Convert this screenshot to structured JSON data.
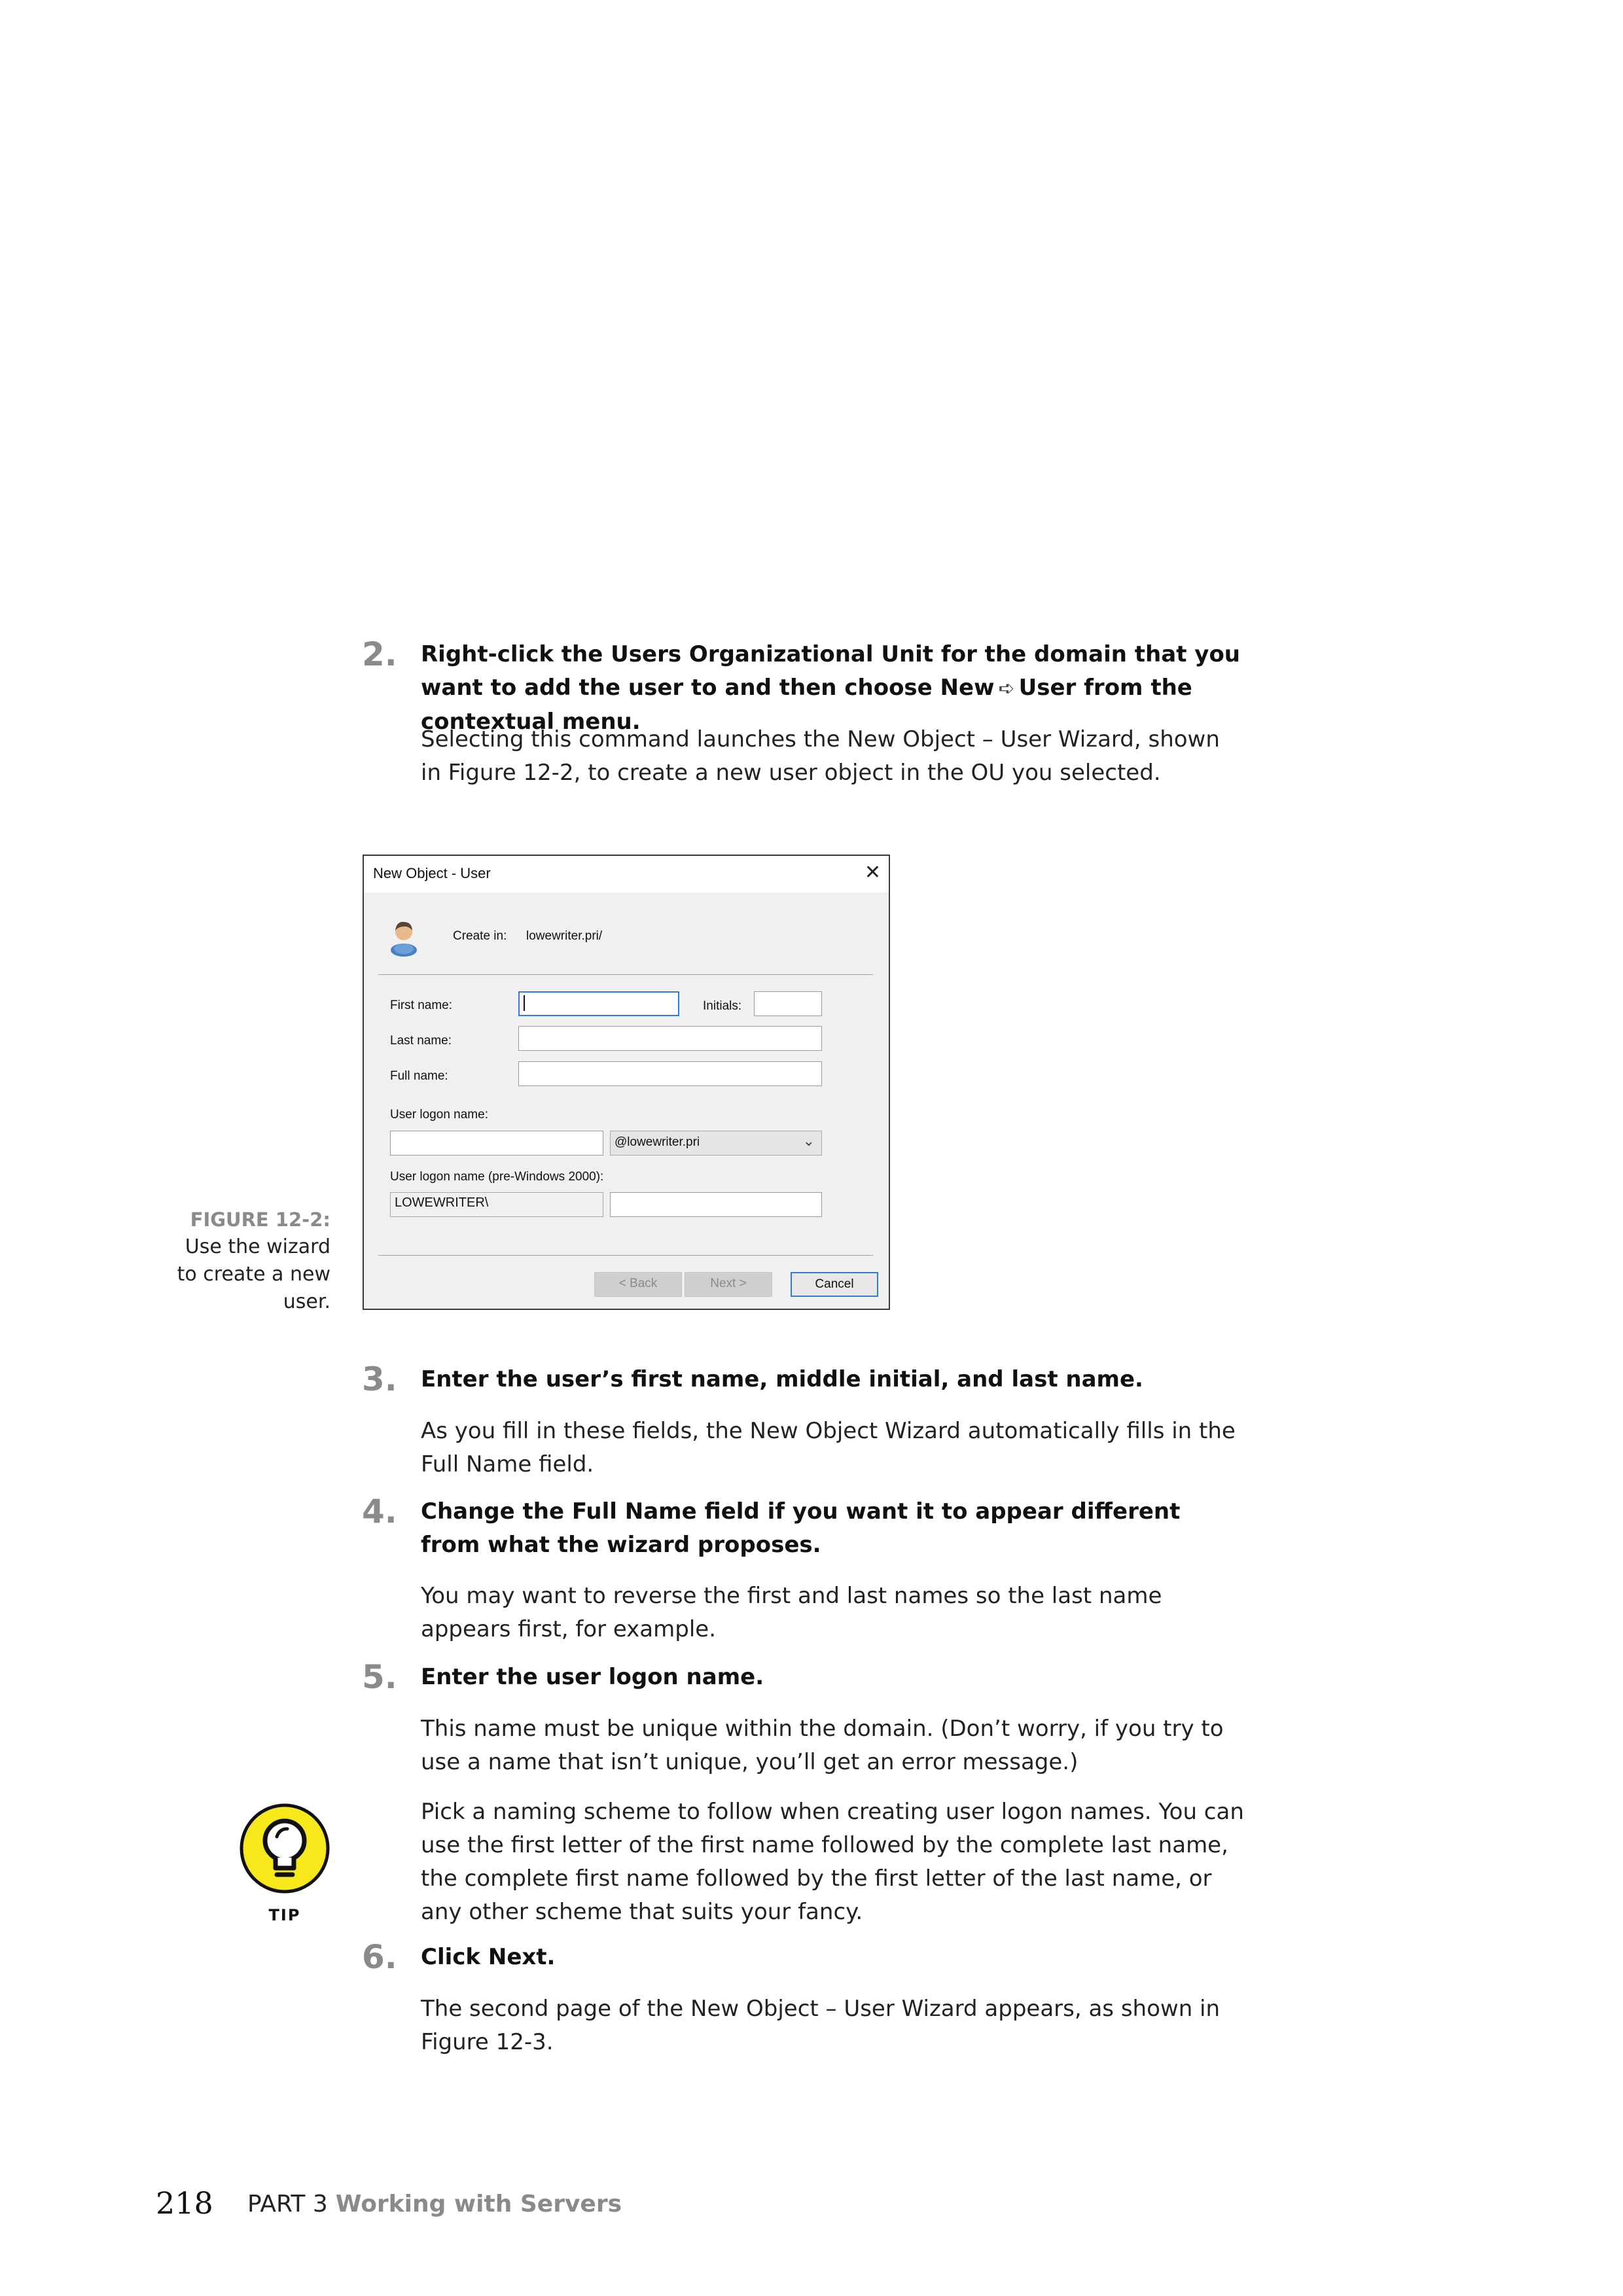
{
  "steps": [
    {
      "num": "2.",
      "heading_part1": "Right-click the Users Organizational Unit for the domain that you want to add the user to and then choose New",
      "heading_arrow": "➪",
      "heading_part2": "User from the contextual menu.",
      "paras": [
        "Selecting this command launches the New Object – User Wizard, shown in Figure 12-2, to create a new user object in the OU you selected."
      ]
    },
    {
      "num": "3.",
      "heading": "Enter the user’s first name, middle initial, and last name.",
      "paras": [
        "As you fill in these fields, the New Object Wizard automatically fills in the Full Name field."
      ]
    },
    {
      "num": "4.",
      "heading": "Change the Full Name field if you want it to appear different from what the wizard proposes.",
      "paras": [
        "You may want to reverse the first and last names so the last name appears first, for example."
      ]
    },
    {
      "num": "5.",
      "heading": "Enter the user logon name.",
      "paras": [
        "This name must be unique within the domain. (Don’t worry, if you try to use a name that isn’t unique, you’ll get an error message.)",
        "Pick a naming scheme to follow when creating user logon names. You can use the first letter of the first name followed by the complete last name, the complete first name followed by the first letter of the last name, or any other scheme that suits your fancy."
      ]
    },
    {
      "num": "6.",
      "heading": "Click Next.",
      "paras": [
        "The second page of the New Object – User Wizard appears, as shown in Figure 12-3."
      ]
    }
  ],
  "figure": {
    "label": "FIGURE 12-2:",
    "caption": "Use the wizard to create a new user."
  },
  "dialog": {
    "title": "New Object - User",
    "close_glyph": "✕",
    "create_in_label": "Create in:",
    "create_in_value": "lowewriter.pri/",
    "first_name_label": "First name:",
    "initials_label": "Initials:",
    "last_name_label": "Last name:",
    "full_name_label": "Full name:",
    "logon_name_label": "User logon name:",
    "domain_suffix": "@lowewriter.pri",
    "pre2000_label": "User logon name (pre-Windows 2000):",
    "pre2000_domain": "LOWEWRITER\\",
    "back_button": "< Back",
    "next_button": "Next >",
    "cancel_button": "Cancel",
    "user_icon": "user-icon"
  },
  "tip": {
    "label": "TIP",
    "icon": "lightbulb-icon",
    "color": "#f7e81c"
  },
  "footer": {
    "page_number": "218",
    "part": "PART 3",
    "part_title": "Working with Servers"
  }
}
